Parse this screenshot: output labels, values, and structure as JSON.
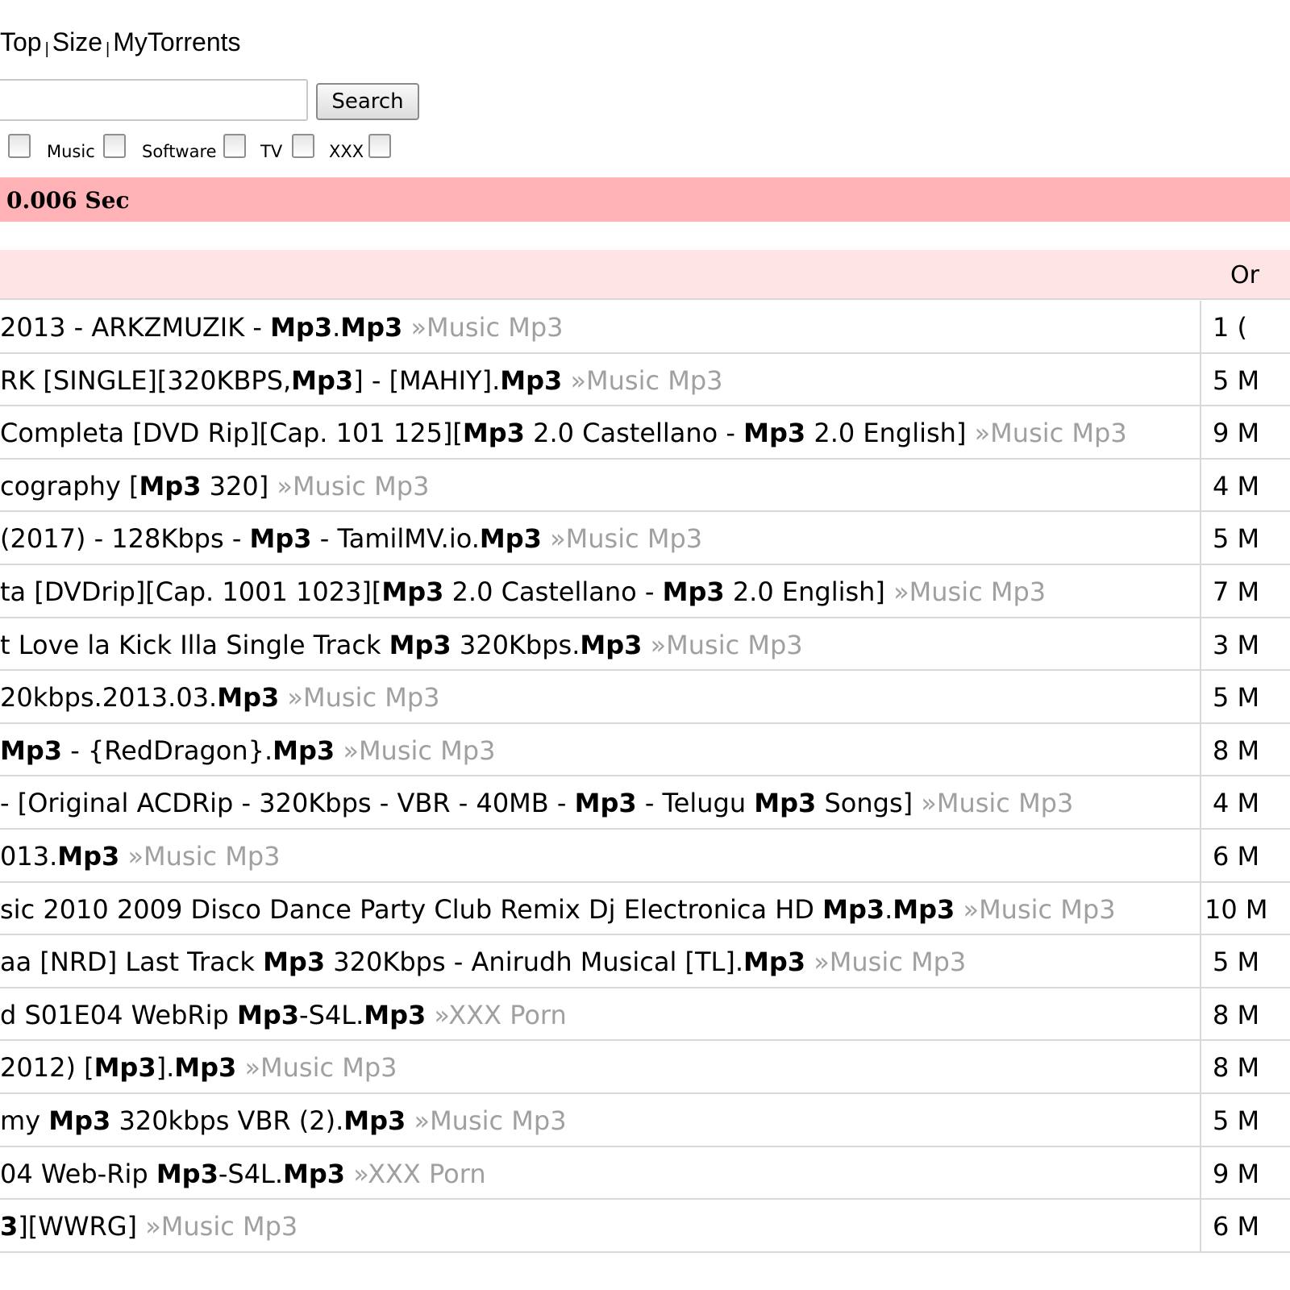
{
  "nav": {
    "items": [
      "Top",
      "Size",
      "MyTorrents"
    ],
    "separator": "|"
  },
  "search": {
    "value": "",
    "button_label": "Search"
  },
  "categories": [
    {
      "label": "",
      "checked": false
    },
    {
      "label": "Music",
      "checked": false
    },
    {
      "label": "Software",
      "checked": false
    },
    {
      "label": "TV",
      "checked": false
    },
    {
      "label": "XXX",
      "checked": false
    }
  ],
  "status": {
    "text": "0.006 Sec",
    "color": "#ffb3b6"
  },
  "table": {
    "header_right": "Or",
    "header_color": "#ffe4e6",
    "rows": [
      {
        "segments": [
          {
            "t": "2013 - ARKZMUZIK - ",
            "b": false
          },
          {
            "t": "Mp3",
            "b": true
          },
          {
            "t": ".",
            "b": false
          },
          {
            "t": "Mp3",
            "b": true
          }
        ],
        "category": " »Music Mp3",
        "count": "1 ("
      },
      {
        "segments": [
          {
            "t": "RK [SINGLE][320KBPS,",
            "b": false
          },
          {
            "t": "Mp3",
            "b": true
          },
          {
            "t": "] - [MAHIY].",
            "b": false
          },
          {
            "t": "Mp3",
            "b": true
          }
        ],
        "category": " »Music Mp3",
        "count": "5 M"
      },
      {
        "segments": [
          {
            "t": "Completa [DVD Rip][Cap. 101 125][",
            "b": false
          },
          {
            "t": "Mp3",
            "b": true
          },
          {
            "t": " 2.0 Castellano - ",
            "b": false
          },
          {
            "t": "Mp3",
            "b": true
          },
          {
            "t": " 2.0 English]",
            "b": false
          }
        ],
        "category": " »Music Mp3",
        "count": "9 M"
      },
      {
        "segments": [
          {
            "t": "cography [",
            "b": false
          },
          {
            "t": "Mp3",
            "b": true
          },
          {
            "t": " 320]",
            "b": false
          }
        ],
        "category": " »Music Mp3",
        "count": "4 M"
      },
      {
        "segments": [
          {
            "t": "(2017) - 128Kbps - ",
            "b": false
          },
          {
            "t": "Mp3",
            "b": true
          },
          {
            "t": " - TamilMV.io.",
            "b": false
          },
          {
            "t": "Mp3",
            "b": true
          }
        ],
        "category": " »Music Mp3",
        "count": "5 M"
      },
      {
        "segments": [
          {
            "t": "ta [DVDrip][Cap. 1001 1023][",
            "b": false
          },
          {
            "t": "Mp3",
            "b": true
          },
          {
            "t": " 2.0 Castellano - ",
            "b": false
          },
          {
            "t": "Mp3",
            "b": true
          },
          {
            "t": " 2.0 English]",
            "b": false
          }
        ],
        "category": " »Music Mp3",
        "count": "7 M"
      },
      {
        "segments": [
          {
            "t": "t Love la Kick Illa Single Track ",
            "b": false
          },
          {
            "t": "Mp3",
            "b": true
          },
          {
            "t": " 320Kbps.",
            "b": false
          },
          {
            "t": "Mp3",
            "b": true
          }
        ],
        "category": " »Music Mp3",
        "count": "3 M"
      },
      {
        "segments": [
          {
            "t": "20kbps.2013.03.",
            "b": false
          },
          {
            "t": "Mp3",
            "b": true
          }
        ],
        "category": " »Music Mp3",
        "count": "5 M"
      },
      {
        "segments": [
          {
            "t": "Mp3",
            "b": true
          },
          {
            "t": " - {RedDragon}.",
            "b": false
          },
          {
            "t": "Mp3",
            "b": true
          }
        ],
        "category": " »Music Mp3",
        "count": "8 M"
      },
      {
        "segments": [
          {
            "t": "- [Original ACDRip - 320Kbps - VBR - 40MB - ",
            "b": false
          },
          {
            "t": "Mp3",
            "b": true
          },
          {
            "t": " - Telugu ",
            "b": false
          },
          {
            "t": "Mp3",
            "b": true
          },
          {
            "t": " Songs]",
            "b": false
          }
        ],
        "category": " »Music Mp3",
        "count": "4 M"
      },
      {
        "segments": [
          {
            "t": "013.",
            "b": false
          },
          {
            "t": "Mp3",
            "b": true
          }
        ],
        "category": " »Music Mp3",
        "count": "6 M"
      },
      {
        "segments": [
          {
            "t": "sic 2010 2009 Disco Dance Party Club Remix Dj Electronica HD ",
            "b": false
          },
          {
            "t": "Mp3",
            "b": true
          },
          {
            "t": ".",
            "b": false
          },
          {
            "t": "Mp3",
            "b": true
          }
        ],
        "category": " »Music Mp3",
        "count": "10 M"
      },
      {
        "segments": [
          {
            "t": "aa [NRD] Last Track ",
            "b": false
          },
          {
            "t": "Mp3",
            "b": true
          },
          {
            "t": " 320Kbps - Anirudh Musical [TL].",
            "b": false
          },
          {
            "t": "Mp3",
            "b": true
          }
        ],
        "category": " »Music Mp3",
        "count": "5 M"
      },
      {
        "segments": [
          {
            "t": "d S01E04 WebRip ",
            "b": false
          },
          {
            "t": "Mp3",
            "b": true
          },
          {
            "t": "-S4L.",
            "b": false
          },
          {
            "t": "Mp3",
            "b": true
          }
        ],
        "category": " »XXX Porn",
        "count": "8 M"
      },
      {
        "segments": [
          {
            "t": " 2012) [",
            "b": false
          },
          {
            "t": "Mp3",
            "b": true
          },
          {
            "t": "].",
            "b": false
          },
          {
            "t": "Mp3",
            "b": true
          }
        ],
        "category": " »Music Mp3",
        "count": "8 M"
      },
      {
        "segments": [
          {
            "t": "my ",
            "b": false
          },
          {
            "t": "Mp3",
            "b": true
          },
          {
            "t": " 320kbps VBR (2).",
            "b": false
          },
          {
            "t": "Mp3",
            "b": true
          }
        ],
        "category": " »Music Mp3",
        "count": "5 M"
      },
      {
        "segments": [
          {
            "t": "04 Web-Rip ",
            "b": false
          },
          {
            "t": "Mp3",
            "b": true
          },
          {
            "t": "-S4L.",
            "b": false
          },
          {
            "t": "Mp3",
            "b": true
          }
        ],
        "category": " »XXX Porn",
        "count": "9 M"
      },
      {
        "segments": [
          {
            "t": "3",
            "b": true
          },
          {
            "t": "][WWRG]",
            "b": false
          }
        ],
        "category": " »Music Mp3",
        "count": "6 M"
      }
    ]
  }
}
